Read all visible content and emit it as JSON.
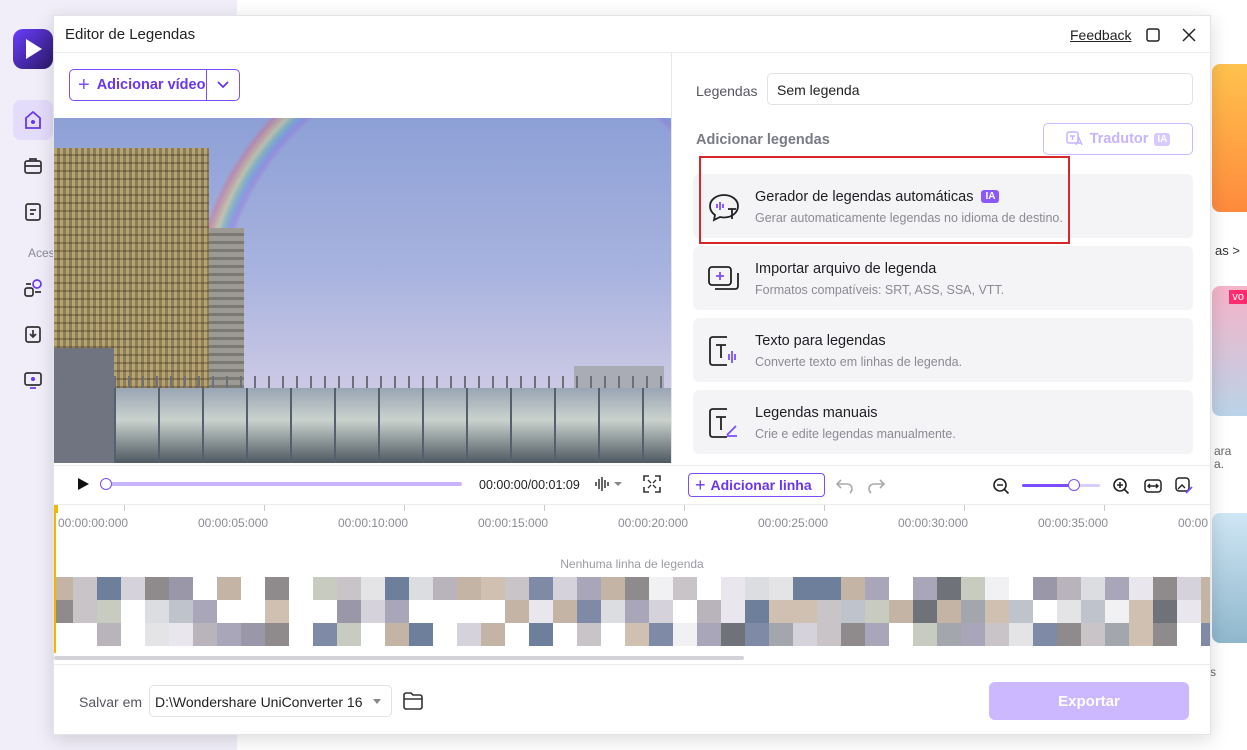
{
  "background": {
    "side_label": "Aces",
    "right_link_partial": "as >",
    "badge_partial": "vo",
    "card_text_1": "ara",
    "card_text_2": "a.",
    "card_text_3": "s"
  },
  "dialog": {
    "title": "Editor de Legendas",
    "feedback": "Feedback"
  },
  "left": {
    "add_video_label": "Adicionar vídeo",
    "timecode": "00:00:00/00:01:09"
  },
  "right": {
    "subs_label": "Legendas",
    "subs_value": "Sem legenda",
    "add_subs_title": "Adicionar legendas",
    "translator_label": "Tradutor",
    "translator_badge": "IA",
    "options": [
      {
        "title": "Gerador de legendas automáticas",
        "badge": "IA",
        "desc": "Gerar automaticamente legendas no idioma de destino."
      },
      {
        "title": "Importar arquivo de legenda",
        "desc": "Formatos compatíveis: SRT, ASS, SSA, VTT."
      },
      {
        "title": "Texto para legendas",
        "desc": "Converte texto em linhas de legenda."
      },
      {
        "title": "Legendas manuais",
        "desc": "Crie e edite legendas manualmente."
      }
    ]
  },
  "timeline": {
    "add_line_label": "Adicionar linha",
    "ticks": [
      "00:00:00:000",
      "00:00:05:000",
      "00:00:10:000",
      "00:00:15:000",
      "00:00:20:000",
      "00:00:25:000",
      "00:00:30:000",
      "00:00:35:000",
      "00:00"
    ],
    "empty_label": "Nenhuma linha de legenda",
    "zoom_level": 0.67
  },
  "footer": {
    "save_label": "Salvar em",
    "save_path": "D:\\Wondershare UniConverter 16",
    "export_label": "Exportar"
  },
  "colors": {
    "accent": "#7b4dff",
    "highlight": "#d62828",
    "playhead": "#f2b600"
  }
}
